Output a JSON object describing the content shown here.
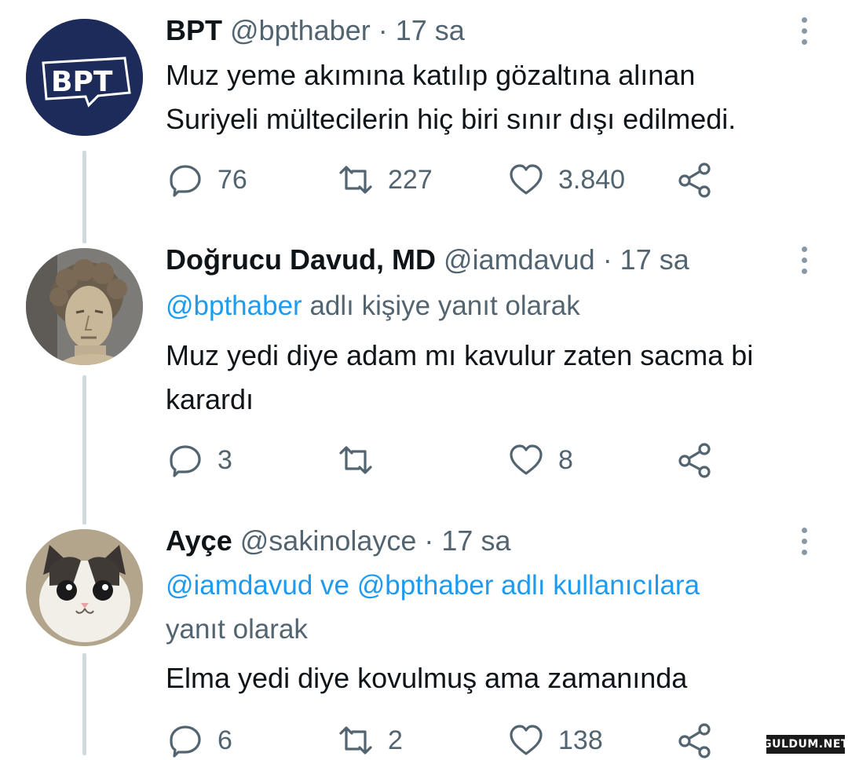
{
  "tweets": [
    {
      "name": "BPT",
      "handle": "@bpthaber",
      "time": "· 17 sa",
      "avatar_text": "BPT",
      "text_lines": [
        "Muz yeme akımına katılıp gözaltına alınan",
        "Suriyeli mültecilerin hiç biri sınır dışı edilmedi."
      ],
      "replies": "76",
      "retweets": "227",
      "likes": "3.840"
    },
    {
      "name": "Doğrucu Davud, MD",
      "handle": "@iamdavud",
      "time": "· 17 sa",
      "reply_mention": "@bpthaber",
      "reply_suffix": "adlı kişiye yanıt olarak",
      "text_lines": [
        "Muz yedi diye adam mı kavulur zaten sacma bi",
        "karardı"
      ],
      "replies": "3",
      "retweets": "",
      "likes": "8"
    },
    {
      "name": "Ayçe",
      "handle": "@sakinolayce",
      "time": "· 17 sa",
      "reply_mention": "@iamdavud ve @bpthaber adlı kullanıcılara",
      "reply_suffix": "yanıt olarak",
      "text_lines": [
        "Elma yedi diye kovulmuş ama zamanında"
      ],
      "replies": "6",
      "retweets": "2",
      "likes": "138"
    }
  ],
  "icons": {
    "reply": "speech-bubble-icon",
    "retweet": "retweet-arrows-icon",
    "like": "heart-icon",
    "share": "share-nodes-icon",
    "more": "vertical-dots-icon"
  },
  "colors": {
    "link": "#1d9bf0",
    "secondary": "#536471",
    "text": "#0f1419",
    "thread_line": "#cfd9de",
    "bpt_avatar_bg": "#1c2b5a"
  },
  "watermark": "GULDUM.NET"
}
